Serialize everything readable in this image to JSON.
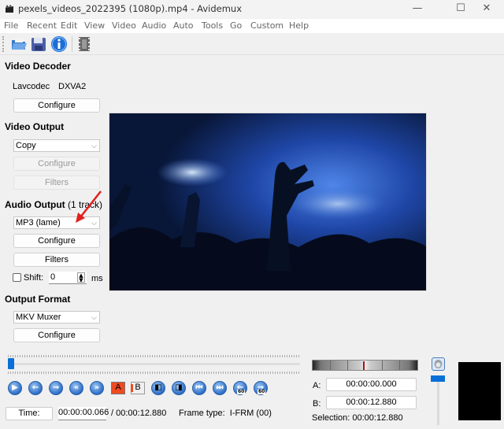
{
  "window": {
    "title": "pexels_videos_2022395 (1080p).mp4 - Avidemux",
    "controls": {
      "minimize": "—",
      "maximize": "☐",
      "close": "✕"
    }
  },
  "menu": [
    "File",
    "Recent",
    "Edit",
    "View",
    "Video",
    "Audio",
    "Auto",
    "Tools",
    "Go",
    "Custom",
    "Help"
  ],
  "toolbar": [
    {
      "name": "open-icon"
    },
    {
      "name": "save-icon"
    },
    {
      "name": "info-icon"
    },
    {
      "name": "film-properties-icon"
    }
  ],
  "video_decoder": {
    "title": "Video Decoder",
    "decoder": "Lavcodec",
    "accel": "DXVA2",
    "configure_label": "Configure"
  },
  "video_output": {
    "title": "Video Output",
    "codec": "Copy",
    "configure_label": "Configure",
    "filters_label": "Filters"
  },
  "audio_output": {
    "title": "Audio Output",
    "track_info": "(1 track)",
    "codec": "MP3 (lame)",
    "configure_label": "Configure",
    "filters_label": "Filters",
    "shift_label": "Shift:",
    "shift_value": "0",
    "shift_unit": "ms",
    "shift_checked": false
  },
  "output_format": {
    "title": "Output Format",
    "muxer": "MKV Muxer",
    "configure_label": "Configure"
  },
  "timeline": {
    "position_fraction": 0.005
  },
  "navigation": {
    "buttons": [
      {
        "name": "play-button",
        "glyph": "▶"
      },
      {
        "name": "previous-frame-button",
        "glyph": "←"
      },
      {
        "name": "next-frame-button",
        "glyph": "→"
      },
      {
        "name": "previous-keyframe-button",
        "glyph": "«"
      },
      {
        "name": "next-keyframe-button",
        "glyph": "»"
      }
    ],
    "marker_a_label": "A",
    "marker_b_label": "B",
    "seek_buttons": [
      {
        "name": "go-to-marker-a-button",
        "glyph": "◧"
      },
      {
        "name": "go-to-marker-b-button",
        "glyph": "◨"
      },
      {
        "name": "go-to-first-frame-button",
        "glyph": "⏮"
      },
      {
        "name": "go-to-last-frame-button",
        "glyph": "⏭"
      },
      {
        "name": "back-60-button",
        "glyph": "←"
      },
      {
        "name": "forward-60-button",
        "glyph": "→"
      }
    ],
    "seek_badge": "60"
  },
  "status": {
    "time_label": "Time:",
    "current_time": "00:00:00.066",
    "total_time": "/ 00:00:12.880",
    "frame_type": "Frame type:  I-FRM (00)"
  },
  "selection": {
    "a_label": "A:",
    "a_value": "00:00:00.000",
    "b_label": "B:",
    "b_value": "00:00:12.880",
    "selection_text": "Selection: 00:00:12.880"
  },
  "volume": {
    "level_fraction": 1.0
  },
  "colors": {
    "accent": "#0a6fd6",
    "annotation_arrow": "#e02020"
  }
}
